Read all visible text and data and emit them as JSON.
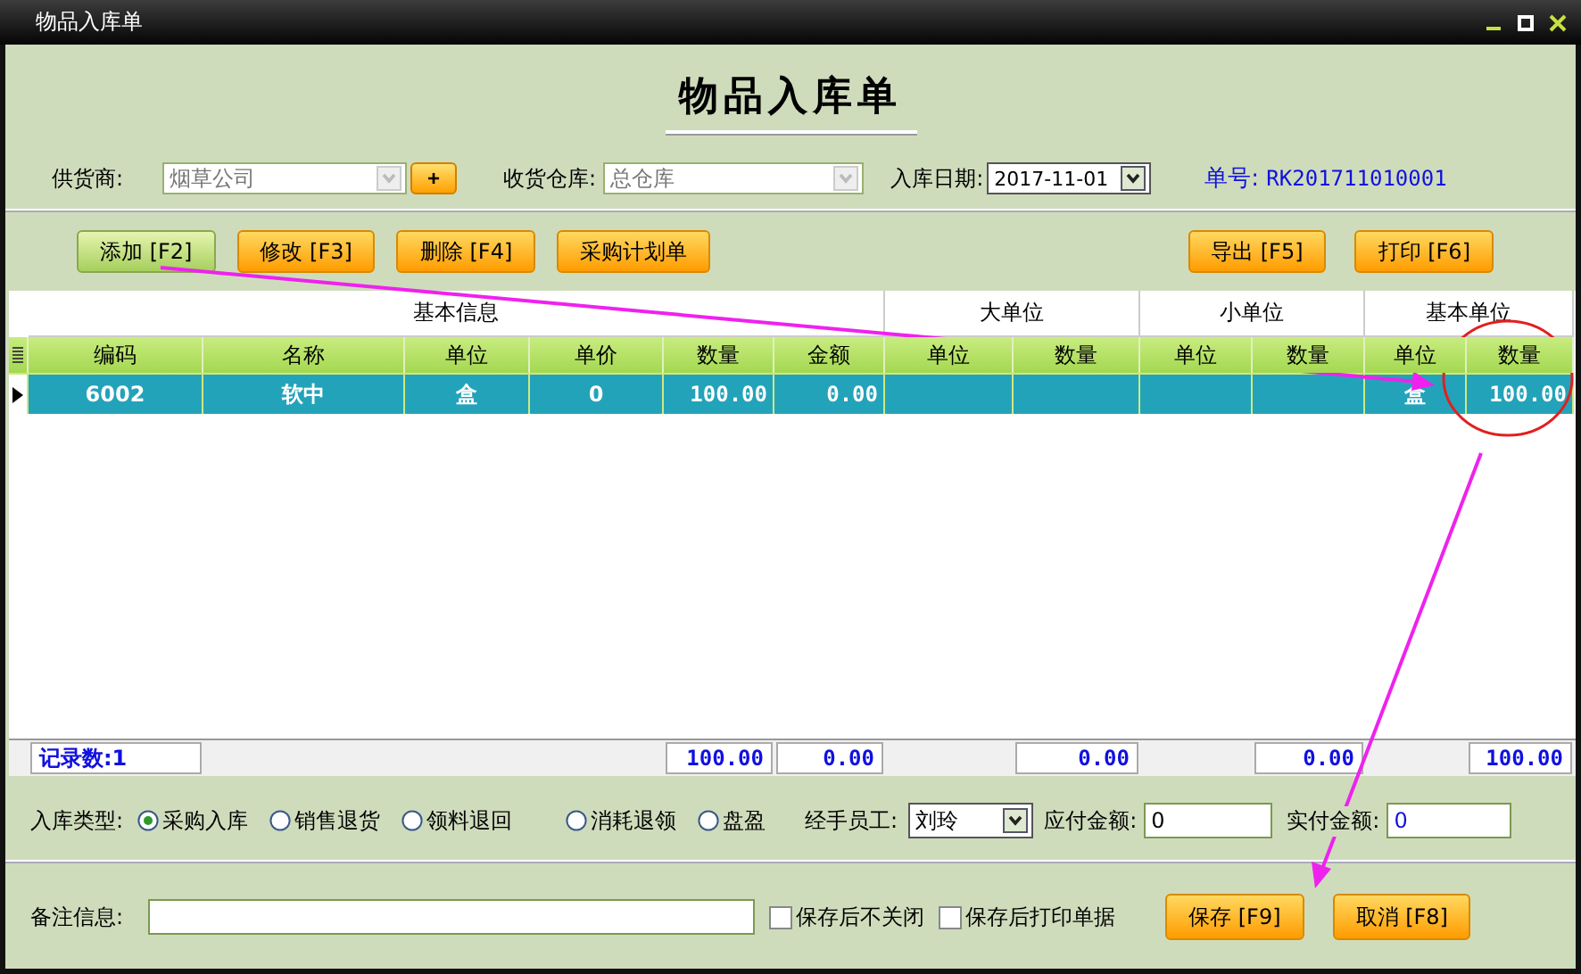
{
  "window": {
    "title": "物品入库单"
  },
  "heading": "物品入库单",
  "form": {
    "supplier": {
      "label": "供货商:",
      "value": "烟草公司",
      "add_button": "+"
    },
    "warehouse": {
      "label": "收货仓库:",
      "value": "总仓库"
    },
    "date": {
      "label": "入库日期:",
      "value": "2017-11-01"
    },
    "order_no": {
      "label": "单号:",
      "value": "RK201711010001"
    }
  },
  "toolbar": {
    "left": [
      {
        "label": "添加 [F2]",
        "selected": true
      },
      {
        "label": "修改 [F3]",
        "selected": false
      },
      {
        "label": "删除 [F4]",
        "selected": false
      },
      {
        "label": "采购计划单",
        "selected": false
      }
    ],
    "right": [
      {
        "label": "导出 [F5]",
        "selected": false
      },
      {
        "label": "打印 [F6]",
        "selected": false
      }
    ]
  },
  "table": {
    "groups": [
      {
        "label": "基本信息",
        "columns": [
          {
            "label": "编码"
          },
          {
            "label": "名称"
          },
          {
            "label": "单位"
          },
          {
            "label": "单价"
          },
          {
            "label": "数量",
            "total": "100.00"
          },
          {
            "label": "金额",
            "total": "0.00"
          }
        ]
      },
      {
        "label": "大单位",
        "columns": [
          {
            "label": "单位"
          },
          {
            "label": "数量",
            "total": "0.00"
          }
        ]
      },
      {
        "label": "小单位",
        "columns": [
          {
            "label": "单位"
          },
          {
            "label": "数量",
            "total": "0.00"
          }
        ]
      },
      {
        "label": "基本单位",
        "columns": [
          {
            "label": "单位"
          },
          {
            "label": "数量",
            "total": "100.00"
          }
        ]
      }
    ],
    "rows": [
      {
        "selected": true,
        "cells": [
          "6002",
          "软中",
          "盒",
          "0",
          "100.00",
          "0.00",
          null,
          null,
          null,
          null,
          "盒",
          "100.00"
        ]
      }
    ],
    "footer": {
      "record_count": "记录数:1"
    }
  },
  "inbound_type": {
    "label": "入库类型:",
    "options": [
      {
        "label": "采购入库",
        "selected": true
      },
      {
        "label": "销售退货",
        "selected": false
      },
      {
        "label": "领料退回",
        "selected": false
      },
      {
        "label": "消耗退领",
        "selected": false
      },
      {
        "label": "盘盈",
        "selected": false
      }
    ]
  },
  "handler": {
    "label": "经手员工:",
    "value": "刘玲"
  },
  "payable": {
    "label": "应付金额:",
    "value": "0"
  },
  "paid": {
    "label": "实付金额:",
    "value": "0"
  },
  "remarks": {
    "label": "备注信息:"
  },
  "options": [
    {
      "label": "保存后不关闭",
      "checked": false
    },
    {
      "label": "保存后打印单据",
      "checked": false
    }
  ],
  "actions": [
    "保存 [F9]",
    "取消 [F8]"
  ]
}
